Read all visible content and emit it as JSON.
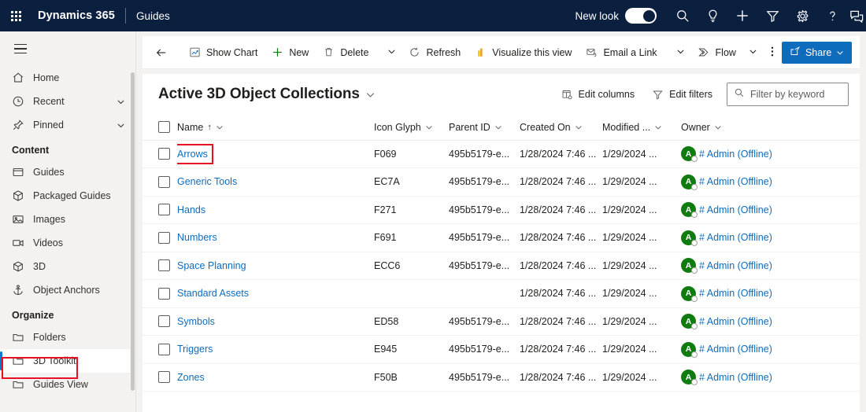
{
  "topnav": {
    "waffle_title": "App launcher",
    "brand": "Dynamics 365",
    "app_name": "Guides",
    "new_look_label": "New look",
    "toggle_state": "on",
    "icons": [
      {
        "name": "search-icon",
        "label": "Search"
      },
      {
        "name": "lightbulb-icon",
        "label": "Tips"
      },
      {
        "name": "plus-icon",
        "label": "Quick create"
      },
      {
        "name": "filter-icon",
        "label": "Filter"
      },
      {
        "name": "gear-icon",
        "label": "Settings"
      },
      {
        "name": "help-icon",
        "label": "Help"
      },
      {
        "name": "chat-icon",
        "label": "Feedback"
      }
    ]
  },
  "sidebar": {
    "hamburger_label": "Show/Hide navigation",
    "top_items": [
      {
        "label": "Home",
        "icon": "home-icon",
        "chevron": false
      },
      {
        "label": "Recent",
        "icon": "clock-icon",
        "chevron": true
      },
      {
        "label": "Pinned",
        "icon": "pin-icon",
        "chevron": true
      }
    ],
    "groups": [
      {
        "title": "Content",
        "items": [
          {
            "label": "Guides",
            "icon": "guides-icon",
            "selected": false
          },
          {
            "label": "Packaged Guides",
            "icon": "package-icon",
            "selected": false
          },
          {
            "label": "Images",
            "icon": "image-icon",
            "selected": false
          },
          {
            "label": "Videos",
            "icon": "video-icon",
            "selected": false
          },
          {
            "label": "3D",
            "icon": "cube-icon",
            "selected": false
          },
          {
            "label": "Object Anchors",
            "icon": "anchor-icon",
            "selected": false
          }
        ]
      },
      {
        "title": "Organize",
        "items": [
          {
            "label": "Folders",
            "icon": "folder-icon",
            "selected": false
          },
          {
            "label": "3D Toolkit",
            "icon": "folder-icon",
            "selected": true
          },
          {
            "label": "Guides View",
            "icon": "folder-icon",
            "selected": false
          }
        ]
      }
    ]
  },
  "command_bar": {
    "back_label": "Back",
    "commands": [
      {
        "label": "Show Chart",
        "icon": "chart-icon"
      },
      {
        "label": "New",
        "icon": "plus-icon"
      },
      {
        "label": "Delete",
        "icon": "trash-icon"
      },
      {
        "label": "Refresh",
        "icon": "refresh-icon"
      },
      {
        "label": "Visualize this view",
        "icon": "powerbi-icon"
      },
      {
        "label": "Email a Link",
        "icon": "email-icon"
      },
      {
        "label": "Flow",
        "icon": "flow-icon"
      }
    ],
    "overflow_label": "More commands",
    "share_label": "Share"
  },
  "view": {
    "title": "Active 3D Object Collections",
    "edit_columns_label": "Edit columns",
    "edit_filters_label": "Edit filters",
    "search_placeholder": "Filter by keyword",
    "search_value": ""
  },
  "grid": {
    "columns": [
      {
        "label": "Name",
        "sorted": true,
        "sort_dir": "asc"
      },
      {
        "label": "Icon Glyph",
        "sorted": false
      },
      {
        "label": "Parent ID",
        "sorted": false
      },
      {
        "label": "Created On",
        "sorted": false
      },
      {
        "label": "Modified ...",
        "sorted": false
      },
      {
        "label": "Owner",
        "sorted": false
      }
    ],
    "rows": [
      {
        "name": "Arrows",
        "glyph": "F069",
        "parent": "495b5179-e...",
        "created": "1/28/2024 7:46 ...",
        "modified": "1/29/2024 ...",
        "owner": "# Admin (Offline)",
        "owner_initial": "A",
        "highlighted": true
      },
      {
        "name": "Generic Tools",
        "glyph": "EC7A",
        "parent": "495b5179-e...",
        "created": "1/28/2024 7:46 ...",
        "modified": "1/29/2024 ...",
        "owner": "# Admin (Offline)",
        "owner_initial": "A",
        "highlighted": false
      },
      {
        "name": "Hands",
        "glyph": "F271",
        "parent": "495b5179-e...",
        "created": "1/28/2024 7:46 ...",
        "modified": "1/29/2024 ...",
        "owner": "# Admin (Offline)",
        "owner_initial": "A",
        "highlighted": false
      },
      {
        "name": "Numbers",
        "glyph": "F691",
        "parent": "495b5179-e...",
        "created": "1/28/2024 7:46 ...",
        "modified": "1/29/2024 ...",
        "owner": "# Admin (Offline)",
        "owner_initial": "A",
        "highlighted": false
      },
      {
        "name": "Space Planning",
        "glyph": "ECC6",
        "parent": "495b5179-e...",
        "created": "1/28/2024 7:46 ...",
        "modified": "1/29/2024 ...",
        "owner": "# Admin (Offline)",
        "owner_initial": "A",
        "highlighted": false
      },
      {
        "name": "Standard Assets",
        "glyph": "",
        "parent": "",
        "created": "1/28/2024 7:46 ...",
        "modified": "1/29/2024 ...",
        "owner": "# Admin (Offline)",
        "owner_initial": "A",
        "highlighted": false
      },
      {
        "name": "Symbols",
        "glyph": "ED58",
        "parent": "495b5179-e...",
        "created": "1/28/2024 7:46 ...",
        "modified": "1/29/2024 ...",
        "owner": "# Admin (Offline)",
        "owner_initial": "A",
        "highlighted": false
      },
      {
        "name": "Triggers",
        "glyph": "E945",
        "parent": "495b5179-e...",
        "created": "1/28/2024 7:46 ...",
        "modified": "1/29/2024 ...",
        "owner": "# Admin (Offline)",
        "owner_initial": "A",
        "highlighted": false
      },
      {
        "name": "Zones",
        "glyph": "F50B",
        "parent": "495b5179-e...",
        "created": "1/28/2024 7:46 ...",
        "modified": "1/29/2024 ...",
        "owner": "# Admin (Offline)",
        "owner_initial": "A",
        "highlighted": false
      }
    ]
  },
  "colors": {
    "nav_background": "#0b1f3f",
    "accent": "#0f6cbd",
    "link": "#0f6cbd",
    "highlight_box": "#e81123",
    "avatar_green": "#107c10",
    "page_background": "#f3f2f1"
  }
}
